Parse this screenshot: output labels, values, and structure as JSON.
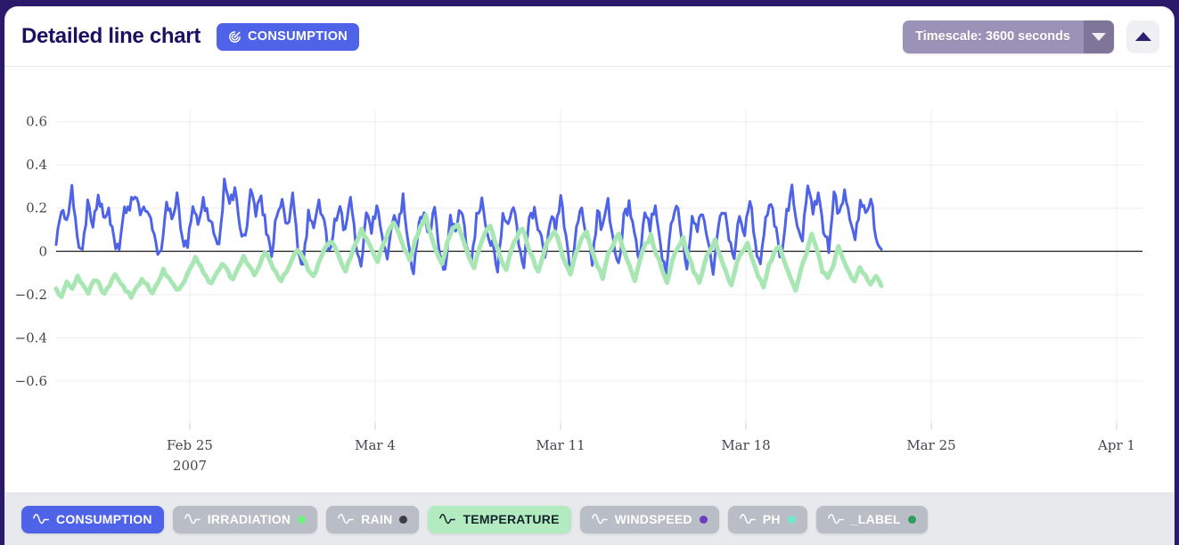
{
  "header": {
    "title": "Detailed line chart",
    "badge": {
      "label": "CONSUMPTION",
      "icon": "target-icon",
      "color": "#4f63e8"
    },
    "timescale": {
      "label": "Timescale: 3600 seconds",
      "icon": "chevron-down-icon",
      "color": "#9b92b8"
    },
    "collapse": {
      "icon": "chevron-up-icon",
      "label": ""
    }
  },
  "legend": {
    "items": [
      {
        "label": "CONSUMPTION",
        "state": "active",
        "chip_color": "#4f63e8",
        "dot_color": null,
        "icon": "wave-icon"
      },
      {
        "label": "IRRADIATION",
        "state": "inactive",
        "chip_color": "#b9bdc6",
        "dot_color": "#6ff07e",
        "icon": "wave-icon"
      },
      {
        "label": "RAIN",
        "state": "inactive",
        "chip_color": "#b9bdc6",
        "dot_color": "#3d3d46",
        "icon": "wave-icon"
      },
      {
        "label": "TEMPERATURE",
        "state": "active",
        "chip_color": "#b3ebc0",
        "dot_color": null,
        "icon": "wave-icon"
      },
      {
        "label": "WINDSPEED",
        "state": "inactive",
        "chip_color": "#b9bdc6",
        "dot_color": "#6b3fbd",
        "icon": "wave-icon"
      },
      {
        "label": "PH",
        "state": "inactive",
        "chip_color": "#b9bdc6",
        "dot_color": "#6ae9cd",
        "icon": "wave-icon"
      },
      {
        "label": "_LABEL",
        "state": "inactive",
        "chip_color": "#b9bdc6",
        "dot_color": "#2f9e5c",
        "icon": "wave-icon"
      }
    ]
  },
  "chart_data": {
    "type": "line",
    "title": "Detailed line chart",
    "xlabel": "",
    "ylabel": "",
    "grid": true,
    "legend_position": "bottom",
    "ylim": [
      -0.72,
      0.78
    ],
    "yticks": [
      0.6,
      0.4,
      0.2,
      0,
      -0.2,
      -0.4,
      -0.6
    ],
    "ytick_labels": [
      "0.6",
      "0.4",
      "0.2",
      "0",
      "−0.2",
      "−0.4",
      "−0.6"
    ],
    "xlim": [
      "2007-02-22",
      "2007-04-03"
    ],
    "xticks": [
      "2007-02-25",
      "2007-03-04",
      "2007-03-11",
      "2007-03-18",
      "2007-03-25",
      "2007-04-01"
    ],
    "xtick_labels": [
      "Feb 25",
      "Mar 4",
      "Mar 11",
      "Mar 18",
      "Mar 25",
      "Apr 1"
    ],
    "xtick_sublabels": [
      "2007",
      "",
      "",
      "",
      "",
      ""
    ],
    "zero_line": true,
    "data_end_x": "2007-03-23",
    "series": [
      {
        "name": "CONSUMPTION",
        "color": "#4f63e8",
        "width": 3,
        "note": "high-frequency diurnal oscillation, amplitude ~0.0 to 0.32 early, settling to ~-0.15 to 0.30",
        "values": [
          0.02,
          0.2,
          0.13,
          0.32,
          0.05,
          0.01,
          0.22,
          0.12,
          0.26,
          0.16,
          0.19,
          0.05,
          0.0,
          0.18,
          0.21,
          0.27,
          0.16,
          0.2,
          0.13,
          0.02,
          0.0,
          0.23,
          0.15,
          0.26,
          0.06,
          0.03,
          0.21,
          0.13,
          0.23,
          0.17,
          0.09,
          0.01,
          0.32,
          0.22,
          0.28,
          0.12,
          0.05,
          0.27,
          0.18,
          0.24,
          0.1,
          -0.04,
          0.19,
          0.22,
          0.11,
          0.26,
          0.01,
          -0.06,
          0.17,
          0.09,
          0.22,
          0.12,
          -0.02,
          0.15,
          0.2,
          0.08,
          0.27,
          0.04,
          -0.08,
          0.18,
          0.11,
          0.21,
          0.06,
          -0.05,
          0.16,
          0.12,
          0.24,
          0.02,
          -0.09,
          0.14,
          0.19,
          0.07,
          0.22,
          -0.03,
          -0.1,
          0.16,
          0.1,
          0.2,
          0.05,
          -0.07,
          0.15,
          0.23,
          0.09,
          0.03,
          -0.11,
          0.17,
          0.12,
          0.21,
          0.04,
          -0.06,
          0.14,
          0.2,
          0.08,
          -0.02,
          0.16,
          0.11,
          0.25,
          0.06,
          -0.09,
          0.13,
          0.19,
          0.07,
          -0.04,
          0.18,
          0.1,
          0.22,
          0.03,
          -0.08,
          0.15,
          0.21,
          0.09,
          -0.05,
          0.17,
          0.12,
          0.2,
          0.02,
          -0.1,
          0.14,
          0.23,
          0.08,
          -0.06,
          0.16,
          0.11,
          0.19,
          0.05,
          -0.12,
          0.13,
          0.2,
          0.07,
          -0.03,
          0.18,
          0.09,
          0.24,
          0.04,
          -0.07,
          0.15,
          0.22,
          0.1,
          -0.05,
          0.17,
          0.28,
          0.14,
          0.06,
          0.3,
          0.19,
          0.25,
          0.09,
          0.02,
          0.27,
          0.16,
          0.29,
          0.13,
          0.05,
          0.21,
          0.18,
          0.24,
          0.08,
          0.01
        ]
      },
      {
        "name": "TEMPERATURE",
        "color": "#a8e6b4",
        "width": 5,
        "note": "smoother low-frequency series, starts around -0.18, rises toward 0.15 mid-range, ends near -0.15",
        "values": [
          -0.18,
          -0.21,
          -0.14,
          -0.17,
          -0.12,
          -0.16,
          -0.19,
          -0.13,
          -0.15,
          -0.2,
          -0.16,
          -0.11,
          -0.14,
          -0.18,
          -0.21,
          -0.17,
          -0.13,
          -0.16,
          -0.19,
          -0.14,
          -0.09,
          -0.12,
          -0.16,
          -0.18,
          -0.13,
          -0.08,
          -0.02,
          -0.07,
          -0.12,
          -0.15,
          -0.1,
          -0.05,
          -0.09,
          -0.13,
          -0.08,
          -0.03,
          -0.07,
          -0.11,
          -0.06,
          -0.01,
          -0.05,
          -0.1,
          -0.14,
          -0.09,
          -0.04,
          0.01,
          -0.03,
          -0.08,
          -0.12,
          -0.06,
          0.0,
          0.05,
          0.02,
          -0.04,
          -0.09,
          -0.02,
          0.04,
          0.1,
          0.06,
          0.0,
          -0.05,
          0.03,
          0.09,
          0.14,
          0.08,
          0.01,
          -0.04,
          0.05,
          0.11,
          0.16,
          0.07,
          0.0,
          -0.06,
          0.04,
          0.1,
          0.13,
          0.05,
          -0.02,
          -0.08,
          0.02,
          0.08,
          0.12,
          0.04,
          -0.03,
          -0.09,
          0.01,
          0.07,
          0.11,
          0.03,
          -0.04,
          -0.1,
          0.0,
          0.06,
          0.1,
          0.02,
          -0.05,
          -0.11,
          -0.01,
          0.05,
          0.09,
          0.01,
          -0.06,
          -0.12,
          -0.02,
          0.04,
          0.08,
          0.0,
          -0.07,
          -0.13,
          -0.03,
          0.03,
          0.07,
          -0.01,
          -0.08,
          -0.14,
          -0.04,
          0.02,
          0.06,
          -0.02,
          -0.09,
          -0.15,
          -0.05,
          0.01,
          0.05,
          -0.03,
          -0.1,
          -0.16,
          -0.06,
          0.0,
          0.04,
          -0.04,
          -0.11,
          -0.17,
          -0.07,
          -0.01,
          0.03,
          -0.05,
          -0.12,
          -0.18,
          -0.08,
          -0.02,
          0.08,
          0.0,
          -0.09,
          -0.13,
          -0.07,
          0.02,
          -0.04,
          -0.1,
          -0.14,
          -0.08,
          -0.11,
          -0.15,
          -0.12,
          -0.16
        ]
      }
    ]
  }
}
